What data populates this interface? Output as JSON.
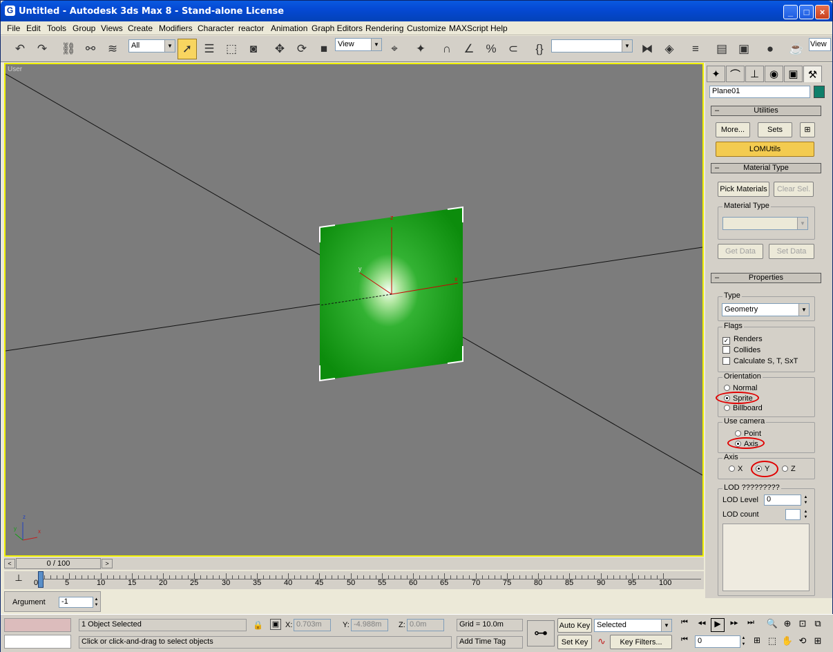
{
  "window": {
    "title": "Untitled - Autodesk 3ds Max 8  - Stand-alone License",
    "app_icon": "3ds-max-icon",
    "controls": [
      "minimize-icon",
      "maximize-icon",
      "close-icon"
    ]
  },
  "menu": [
    "File",
    "Edit",
    "Tools",
    "Group",
    "Views",
    "Create",
    "Modifiers",
    "Character",
    "reactor",
    "Animation",
    "Graph Editors",
    "Rendering",
    "Customize",
    "MAXScript",
    "Help"
  ],
  "toolbar": {
    "selection_filter": "All",
    "ref_coord": "View",
    "named_sel": "",
    "view_label": "View"
  },
  "viewport": {
    "label": "User",
    "axis_tripod": {
      "x": "x",
      "y": "y",
      "z": "z"
    },
    "object_color": "#119c11",
    "border_color": "#f0f000"
  },
  "cmdpanel": {
    "object_name": "Plane01",
    "object_color": "#0f7f6a",
    "utilities": {
      "header": "Utilities",
      "more_label": "More...",
      "sets_label": "Sets",
      "active_utility": "LOMUtils"
    },
    "material_type": {
      "header": "Material Type",
      "pick_label": "Pick Materials",
      "clear_label": "Clear Sel.",
      "group_label": "Material Type",
      "dropdown_value": "",
      "get_label": "Get Data",
      "set_label": "Set Data"
    },
    "properties": {
      "header": "Properties",
      "type_label": "Type",
      "type_value": "Geometry",
      "flags_label": "Flags",
      "flags": [
        {
          "label": "Renders",
          "checked": true
        },
        {
          "label": "Collides",
          "checked": false
        },
        {
          "label": "Calculate S, T, SxT",
          "checked": false
        }
      ],
      "orientation_label": "Orientation",
      "orientation": [
        {
          "label": "Normal",
          "selected": false
        },
        {
          "label": "Sprite",
          "selected": true
        },
        {
          "label": "Billboard",
          "selected": false
        }
      ],
      "use_camera_label": "Use camera",
      "use_camera": [
        {
          "label": "Point",
          "selected": false
        },
        {
          "label": "Axis",
          "selected": true
        }
      ],
      "axis_label": "Axis",
      "axis": [
        {
          "label": "X",
          "selected": false
        },
        {
          "label": "Y",
          "selected": true
        },
        {
          "label": "Z",
          "selected": false
        }
      ],
      "lod_group_label": "LOD ?????????",
      "lod_level_label": "LOD Level",
      "lod_level_value": "0",
      "lod_count_label": "LOD count",
      "lod_count_value": ""
    }
  },
  "timeline": {
    "frame_display": "0 / 100",
    "ticks": [
      "0",
      "5",
      "10",
      "15",
      "20",
      "25",
      "30",
      "35",
      "40",
      "45",
      "50",
      "55",
      "60",
      "65",
      "70",
      "75",
      "80",
      "85",
      "90",
      "95",
      "100"
    ]
  },
  "status": {
    "maxscript_label": "Argument",
    "maxscript_value": "-1",
    "selection_text": "1 Object Selected",
    "prompt_text": "Click or click-and-drag to select objects",
    "x_label": "X:",
    "x_value": "0.703m",
    "y_label": "Y:",
    "y_value": "-4.988m",
    "z_label": "Z:",
    "z_value": "0.0m",
    "grid_text": "Grid = 10.0m",
    "time_tag": "Add Time Tag",
    "auto_key": "Auto Key",
    "set_key": "Set Key",
    "key_mode": "Selected",
    "key_filters": "Key Filters...",
    "current_frame": "0"
  }
}
